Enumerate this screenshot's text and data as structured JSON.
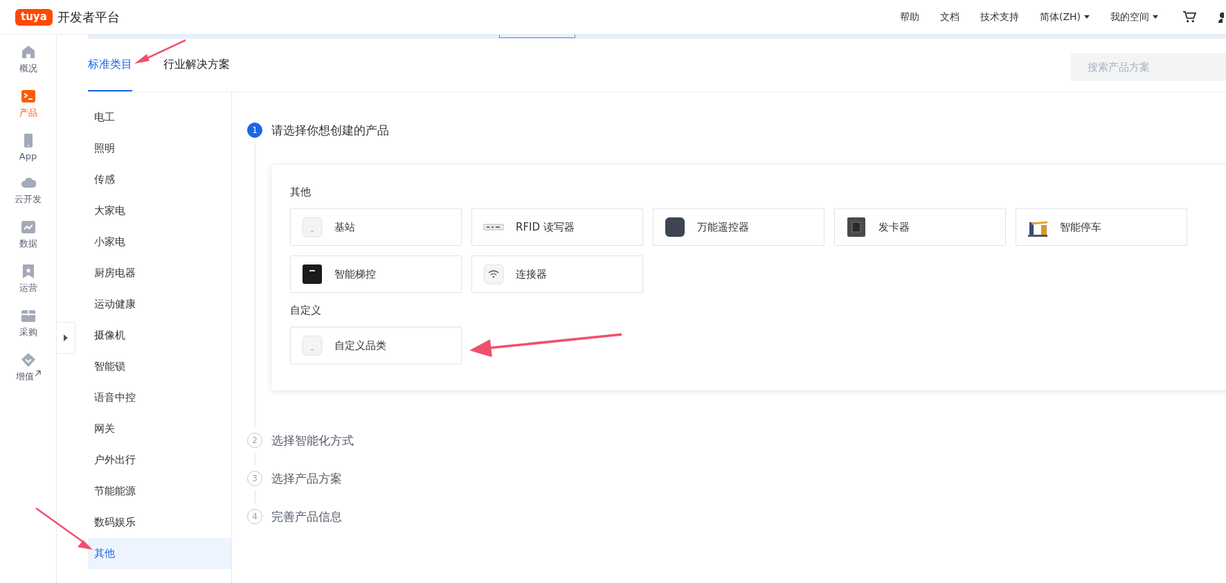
{
  "header": {
    "logo": "tuya",
    "title": "开发者平台",
    "links": [
      {
        "label": "帮助",
        "dropdown": false
      },
      {
        "label": "文档",
        "dropdown": false
      },
      {
        "label": "技术支持",
        "dropdown": false
      },
      {
        "label": "简体(ZH)",
        "dropdown": true
      },
      {
        "label": "我的空间",
        "dropdown": true
      }
    ]
  },
  "nav": [
    {
      "label": "概况",
      "kind": "home",
      "selected": false,
      "external": false
    },
    {
      "label": "产品",
      "kind": "terminal",
      "selected": true,
      "external": false
    },
    {
      "label": "App",
      "kind": "phone",
      "selected": false,
      "external": false
    },
    {
      "label": "云开发",
      "kind": "cloud",
      "selected": false,
      "external": false
    },
    {
      "label": "数据",
      "kind": "chart",
      "selected": false,
      "external": false
    },
    {
      "label": "运营",
      "kind": "bookmark",
      "selected": false,
      "external": false
    },
    {
      "label": "采购",
      "kind": "box",
      "selected": false,
      "external": false
    },
    {
      "label": "增值",
      "kind": "diamond",
      "selected": false,
      "external": true
    }
  ],
  "tabs": [
    {
      "label": "标准类目",
      "selected": true
    },
    {
      "label": "行业解决方案",
      "selected": false
    }
  ],
  "search": {
    "placeholder": "搜索产品方案"
  },
  "categories": [
    {
      "label": "电工",
      "selected": false
    },
    {
      "label": "照明",
      "selected": false
    },
    {
      "label": "传感",
      "selected": false
    },
    {
      "label": "大家电",
      "selected": false
    },
    {
      "label": "小家电",
      "selected": false
    },
    {
      "label": "厨房电器",
      "selected": false
    },
    {
      "label": "运动健康",
      "selected": false
    },
    {
      "label": "摄像机",
      "selected": false
    },
    {
      "label": "智能锁",
      "selected": false
    },
    {
      "label": "语音中控",
      "selected": false
    },
    {
      "label": "网关",
      "selected": false
    },
    {
      "label": "户外出行",
      "selected": false
    },
    {
      "label": "节能能源",
      "selected": false
    },
    {
      "label": "数码娱乐",
      "selected": false
    },
    {
      "label": "其他",
      "selected": true
    }
  ],
  "steps": [
    {
      "number": "1",
      "label": "请选择你想创建的产品",
      "active": true
    },
    {
      "number": "2",
      "label": "选择智能化方式",
      "active": false
    },
    {
      "number": "3",
      "label": "选择产品方案",
      "active": false
    },
    {
      "number": "4",
      "label": "完善产品信息",
      "active": false
    }
  ],
  "groups": [
    {
      "title": "其他",
      "products": [
        {
          "name": "基站",
          "kind": "plain-box"
        },
        {
          "name": "RFID 读写器",
          "kind": "reader"
        },
        {
          "name": "万能遥控器",
          "kind": "dark-square"
        },
        {
          "name": "发卡器",
          "kind": "card-reader"
        },
        {
          "name": "智能停车",
          "kind": "barrier"
        },
        {
          "name": "智能梯控",
          "kind": "panel"
        },
        {
          "name": "连接器",
          "kind": "wifi-box"
        }
      ]
    },
    {
      "title": "自定义",
      "products": [
        {
          "name": "自定义品类",
          "kind": "plain-box"
        }
      ]
    }
  ]
}
